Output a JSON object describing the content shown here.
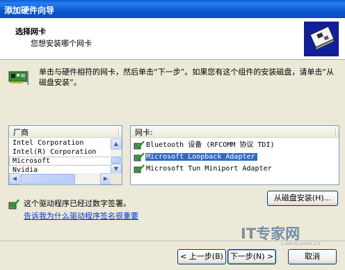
{
  "window": {
    "title": "添加硬件向导"
  },
  "header": {
    "title": "选择网卡",
    "subtitle": "您想安装哪个网卡"
  },
  "intro": {
    "text": "单击与硬件相符的网卡，然后单击“下一步”。如果您有这个组件的安装磁盘，请单击“从磁盘安装”。"
  },
  "manufacturer_list": {
    "header": "厂商",
    "items": [
      "Intel Corporation",
      "Intel(R) Corporation",
      "Microsoft",
      "Nvidia"
    ],
    "selected": "Microsoft"
  },
  "model_list": {
    "header": "网卡:",
    "items": [
      "Bluetooth 设备 (RFCOMM 协议 TDI)",
      "Microsoft Loopback Adapter",
      "Microsoft Tun Miniport Adapter"
    ],
    "selected": "Microsoft Loopback Adapter"
  },
  "driver": {
    "signed_text": "这个驱动程序已经过数字签署。",
    "link_text": "告诉我为什么驱动程序签名很重要"
  },
  "buttons": {
    "have_disk": "从磁盘安装(H)...",
    "back": "< 上一步(B)",
    "next": "下一步(N) >",
    "cancel": "取消"
  },
  "watermark": {
    "brand_it": "IT",
    "brand_rest": "专家网",
    "url": "Ctocio.com.cn"
  },
  "colors": {
    "title_bar": "#0a58d0",
    "selection": "#316ac5",
    "dialog_bg": "#ece9d8",
    "link": "#0033cc"
  }
}
